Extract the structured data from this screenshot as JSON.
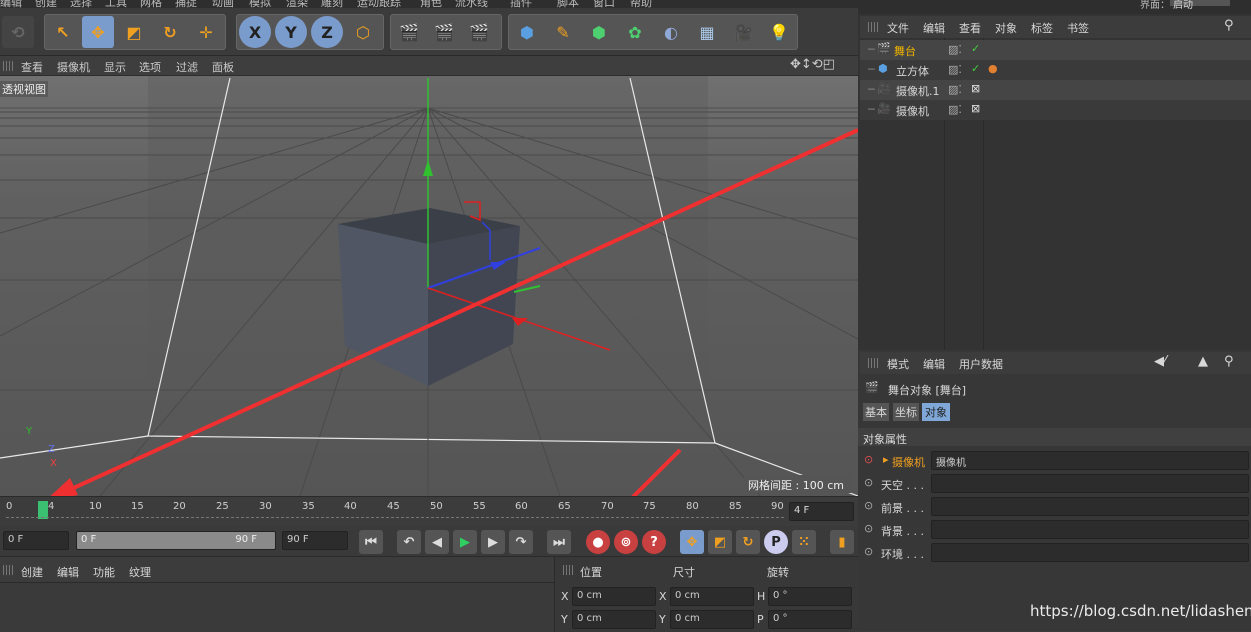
{
  "top_menu": [
    "编辑",
    "创建",
    "选择",
    "工具",
    "网格",
    "捕捉",
    "动画",
    "模拟",
    "渲染",
    "雕刻",
    "运动跟踪",
    "角色",
    "流水线",
    "插件",
    "脚本",
    "窗口",
    "帮助"
  ],
  "top_right_label": "界面：",
  "top_right_value": "启动",
  "viewport_menu": [
    "查看",
    "摄像机",
    "显示",
    "选项",
    "过滤",
    "面板"
  ],
  "viewport_label": "透视视图",
  "grid_spacing": "网格间距 : 100 cm",
  "axis_gizmo": {
    "y": "Y",
    "z": "Z",
    "x": "X"
  },
  "timeline_ticks": [
    "0",
    "4",
    "10",
    "15",
    "20",
    "25",
    "30",
    "35",
    "40",
    "45",
    "50",
    "55",
    "60",
    "65",
    "70",
    "75",
    "80",
    "85",
    "90"
  ],
  "current_frame_display": "4 F",
  "playhead_frame": 4,
  "controls": {
    "start_field": "0 F",
    "range_start": "0 F",
    "range_end": "90 F",
    "end_field": "90 F"
  },
  "bottom_left_menu": [
    "创建",
    "编辑",
    "功能",
    "纹理"
  ],
  "coord_headers": [
    "位置",
    "尺寸",
    "旋转"
  ],
  "coord_rows": [
    {
      "axis": "X",
      "pos": "0 cm",
      "size_axis": "X",
      "size": "0 cm",
      "rot_axis": "H",
      "rot": "0 °"
    },
    {
      "axis": "Y",
      "pos": "0 cm",
      "size_axis": "Y",
      "size": "0 cm",
      "rot_axis": "P",
      "rot": "0 °"
    }
  ],
  "object_manager": {
    "menu": [
      "文件",
      "编辑",
      "查看",
      "对象",
      "标签",
      "书签"
    ],
    "objects": [
      {
        "name": "舞台",
        "color": "#f0b400"
      },
      {
        "name": "立方体",
        "color": "#d8d8d8"
      },
      {
        "name": "摄像机.1",
        "color": "#d8d8d8"
      },
      {
        "name": "摄像机",
        "color": "#d8d8d8"
      }
    ]
  },
  "attribute_manager": {
    "menu": [
      "模式",
      "编辑",
      "用户数据"
    ],
    "title": "舞台对象 [舞台]",
    "tabs": [
      "基本",
      "坐标",
      "对象"
    ],
    "section": "对象属性",
    "rows": [
      {
        "label": "摄像机",
        "value": "摄像机"
      },
      {
        "label": "天空 . . .",
        "value": ""
      },
      {
        "label": "前景 . . .",
        "value": ""
      },
      {
        "label": "背景 . . .",
        "value": ""
      },
      {
        "label": "环境 . . .",
        "value": ""
      }
    ]
  },
  "watermark": "https://blog.csdn.net/lidashent",
  "colors": {
    "accent": "#f0a020",
    "annotation_arrow": "#f03030",
    "selected_tab": "#7fa8d8"
  }
}
